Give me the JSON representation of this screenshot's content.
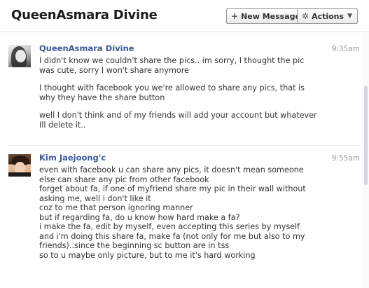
{
  "header": {
    "title": "QueenAsmara Divine",
    "new_message_label": "New Message",
    "new_message_icon": "+",
    "actions_label": "Actions",
    "actions_icon": "✲",
    "actions_caret": "▼"
  },
  "messages": [
    {
      "author": "QueenAsmara Divine",
      "time": "9:35am",
      "paragraphs": [
        [
          "I didn't know we couldn't share the pics.. im sorry, I thought the pic",
          "was cute, sorry I won't share anymore"
        ],
        [
          "I thought with facebook you we're allowed to share any pics, that is",
          "why they have the share button"
        ],
        [
          "well I don't think and of my friends will add your account but whatever",
          "Ill delete it.."
        ]
      ]
    },
    {
      "author": "Kim Jaejoong'c",
      "time": "9:55am",
      "lines": [
        "even with facebook u can share any pics, it doesn't mean someone",
        "else can share any pic from other facebook",
        "forget about fa, if one of myfriend share my pic in their wall without",
        "asking me, well i don't like it",
        "coz to me that person ignoring manner",
        "but if regarding fa, do u know how hard make a fa?",
        "i make the fa, edit by myself, even accepting this series by myself",
        "and i'm doing this share fa, make fa (not only for me but also to my",
        "friends)..since the beginning sc button are in tss",
        "so to u maybe only picture, but to me it's hard working"
      ]
    }
  ]
}
